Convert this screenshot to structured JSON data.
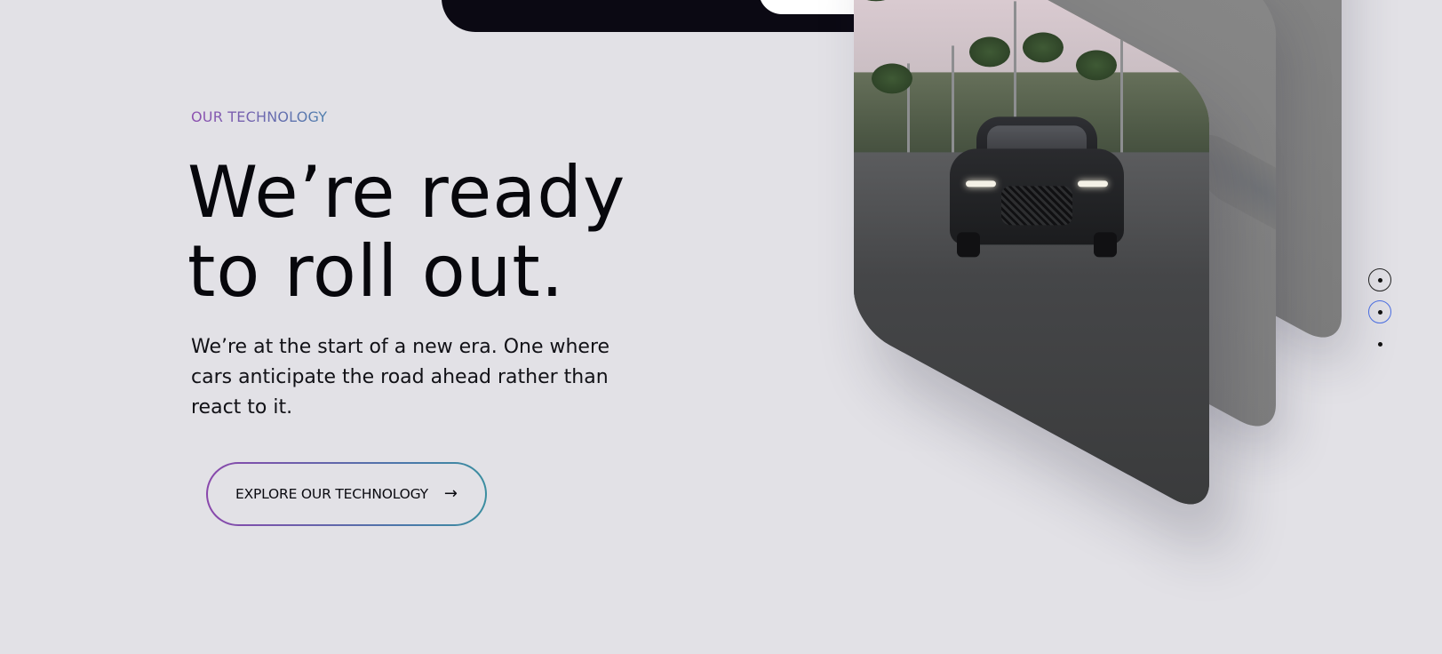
{
  "eyebrow": "OUR TECHNOLOGY",
  "headline": {
    "line1": "We’re ready",
    "line2": "to roll out."
  },
  "body": "We’re at the start of a new era. One where cars anticipate the road ahead rather than react to it.",
  "cta": {
    "label": "EXPLORE OUR TECHNOLOGY",
    "arrow": "→"
  },
  "pager": {
    "count": 3,
    "active_index": 1
  },
  "colors": {
    "background": "#e2e1e6",
    "eyebrow_gradient_start": "#8e4fb0",
    "eyebrow_gradient_end": "#4f7fae",
    "cta_border_start": "#8a47ac",
    "cta_border_end": "#3b8ea0",
    "nav_bar": "#0b0913",
    "active_dot_ring": "#4a6de0"
  },
  "icons": {
    "cta_arrow": "arrow-right-icon"
  }
}
